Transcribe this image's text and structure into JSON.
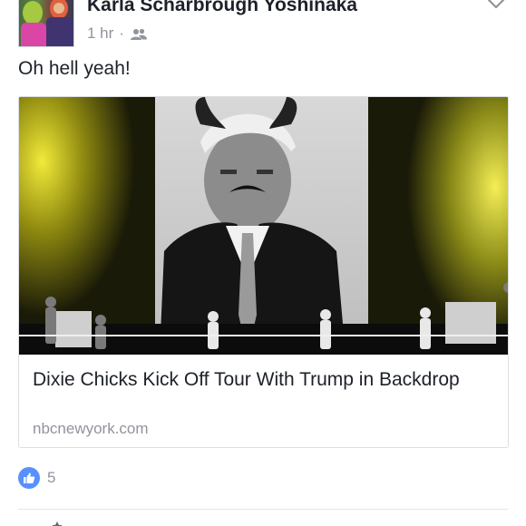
{
  "post": {
    "author": "Karla Scharbrough Yoshinaka",
    "time": "1 hr",
    "separator": "·",
    "audience_icon": "friends-icon",
    "options_icon": "chevron-down-icon",
    "text": "Oh hell yeah!"
  },
  "link": {
    "title": "Dixie Chicks Kick Off Tour With Trump in Backdrop",
    "domain": "nbcnewyork.com"
  },
  "reactions": {
    "icon": "like-icon",
    "count": "5",
    "color": "#5890ff"
  },
  "colors": {
    "text": "#1d2129",
    "meta": "#90949c",
    "border": "#dddfe2",
    "stage_light": "#d7d000"
  }
}
